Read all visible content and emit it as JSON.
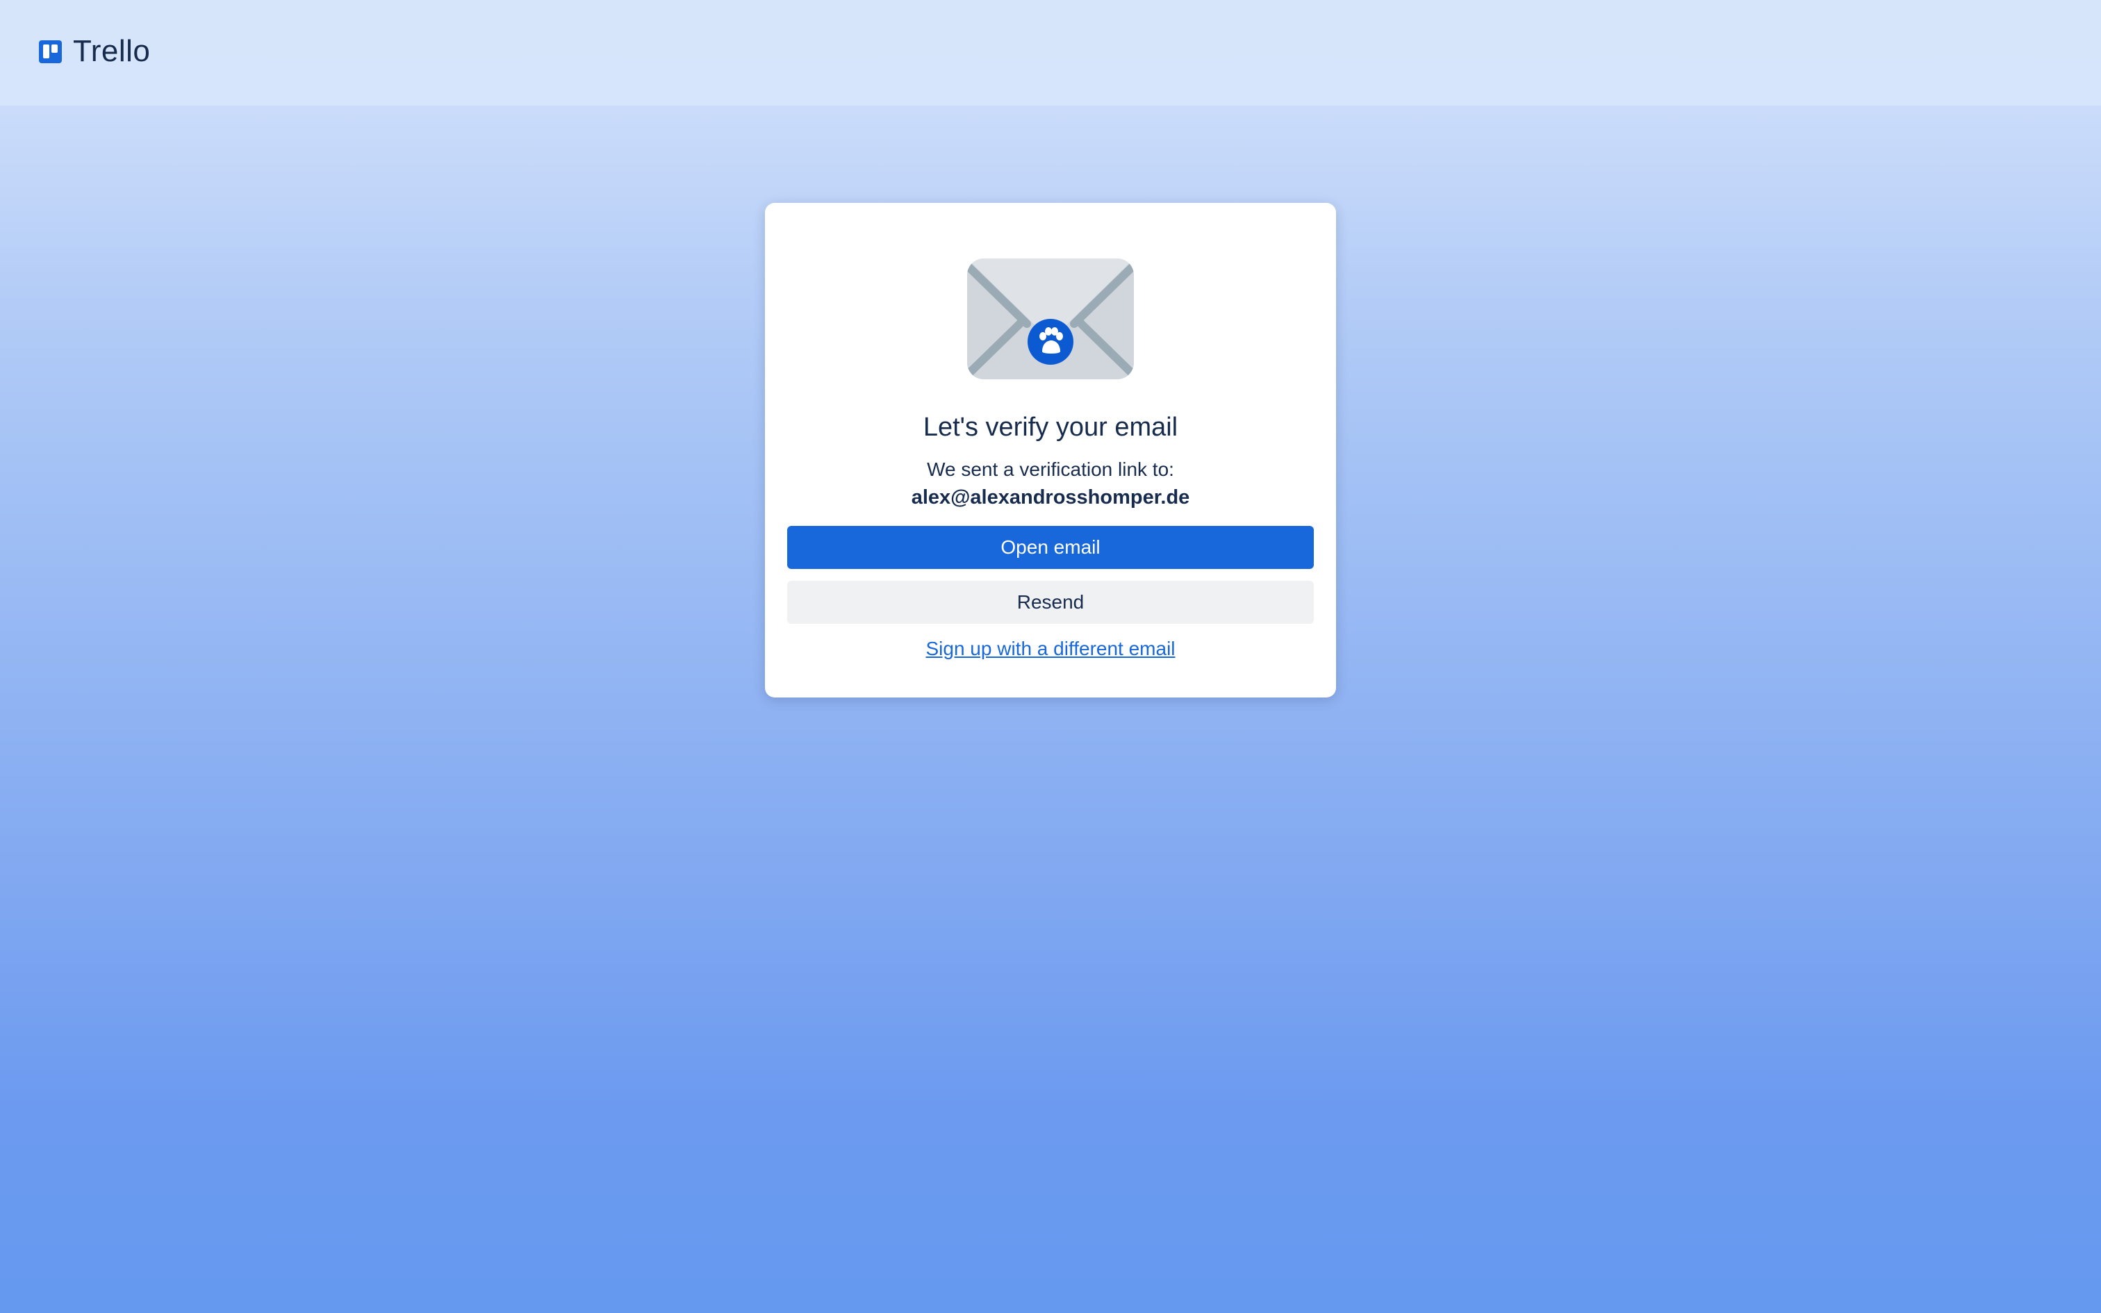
{
  "brand": {
    "name": "Trello",
    "logo_icon": "trello-logo-icon",
    "logo_color": "#1868db"
  },
  "verify_card": {
    "illustration_icon": "envelope-paw-icon",
    "title": "Let's verify your email",
    "sent_text": "We sent a verification link to:",
    "email": "alex@alexandrosshomper.de",
    "open_email_label": "Open email",
    "resend_label": "Resend",
    "different_email_link": "Sign up with a different email"
  },
  "colors": {
    "primary": "#1868db",
    "text": "#172b4d",
    "secondary_button": "#f0f1f2"
  }
}
